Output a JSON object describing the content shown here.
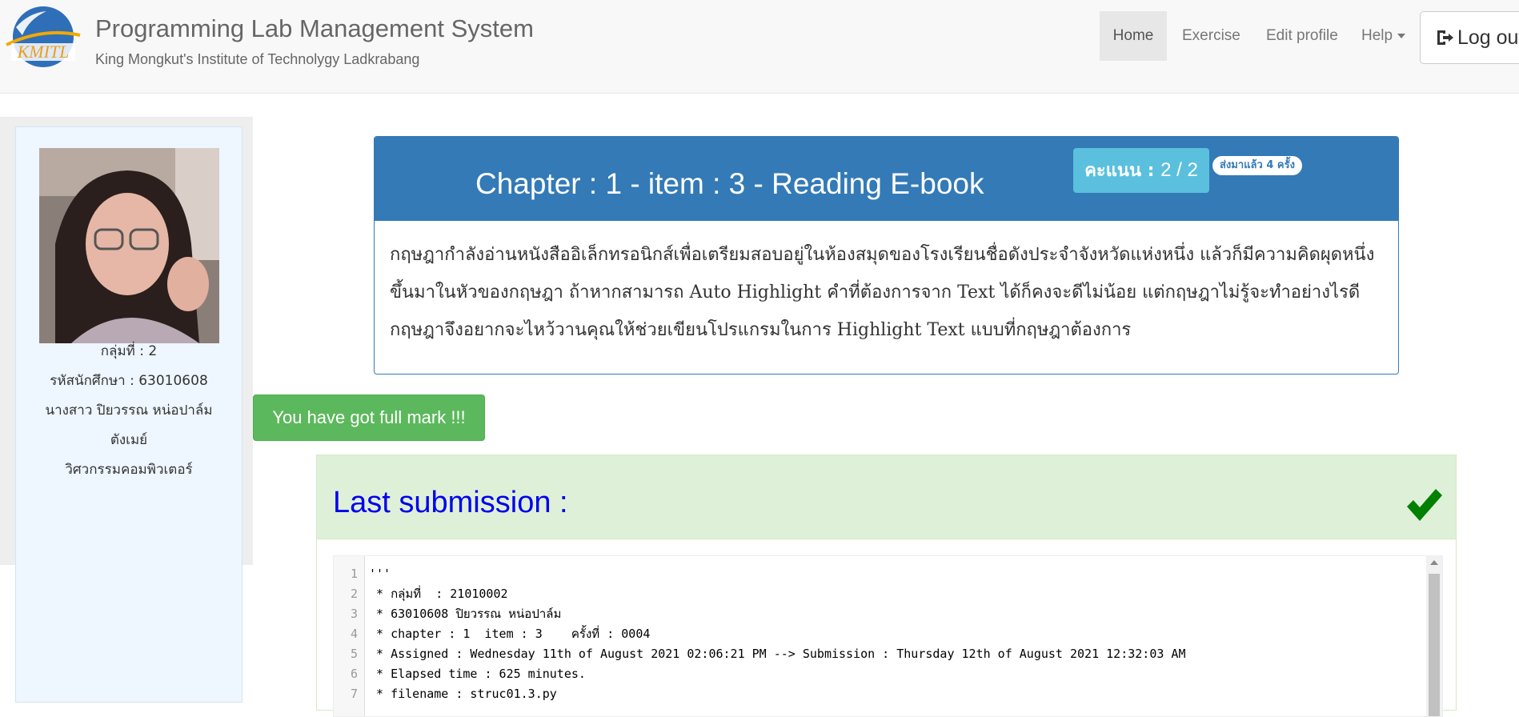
{
  "header": {
    "title": "Programming Lab Management System",
    "subtitle": "King Mongkut's Institute of Technolygy Ladkrabang",
    "logo_text": "KMITL",
    "nav": {
      "home": "Home",
      "exercise": "Exercise",
      "edit_profile": "Edit profile",
      "help": "Help",
      "logout": "Log out"
    }
  },
  "sidebar": {
    "group": "กลุ่มที่ : 2",
    "student_id": "รหัสนักศึกษา : 63010608",
    "name": "นางสาว ปิยวรรณ หน่อปาล์ม",
    "nickname": "ตังเมย์",
    "department": "วิศวกรรมคอมพิวเตอร์"
  },
  "chapter": {
    "title": "Chapter : 1 - item : 3 - Reading E-book",
    "score_label": "คะแนน :",
    "score_value": "2 / 2",
    "submit_count": "ส่งมาแล้ว 4 ครั้ง",
    "description": "กฤษฎากำลังอ่านหนังสืออิเล็กทรอนิกส์เพื่อเตรียมสอบอยู่ในห้องสมุดของโรงเรียนชื่อดังประจำจังหวัดแห่งหนึ่ง แล้วก็มีความคิดผุดหนึ่งขึ้นมาในหัวของกฤษฎา ถ้าหากสามารถ Auto Highlight คำที่ต้องการจาก Text ได้ก็คงจะดีไม่น้อย แต่กฤษฎาไม่รู้จะทำอย่างไรดี กฤษฎาจึงอยากจะไหว้วานคุณให้ช่วยเขียนโปรแกรมในการ Highlight Text แบบที่กฤษฎาต้องการ"
  },
  "full_mark_message": "You have got full mark !!!",
  "submission": {
    "title": "Last submission :",
    "lines": [
      {
        "num": "1",
        "text": "'''"
      },
      {
        "num": "2",
        "text": " * กลุ่มที่  : 21010002"
      },
      {
        "num": "3",
        "text": " * 63010608 ปิยวรรณ หน่อปาล์ม"
      },
      {
        "num": "4",
        "text": " * chapter : 1  item : 3    ครั้งที่ : 0004"
      },
      {
        "num": "5",
        "text": " * Assigned : Wednesday 11th of August 2021 02:06:21 PM --> Submission : Thursday 12th of August 2021 12:32:03 AM"
      },
      {
        "num": "6",
        "text": " * Elapsed time : 625 minutes."
      },
      {
        "num": "7",
        "text": " * filename : struc01.3.py"
      }
    ]
  },
  "colors": {
    "primary": "#337ab7",
    "info": "#5bc0de",
    "success": "#5cb85c",
    "success_bg": "#dff0d8",
    "check": "#008000",
    "link": "#0000ee"
  }
}
